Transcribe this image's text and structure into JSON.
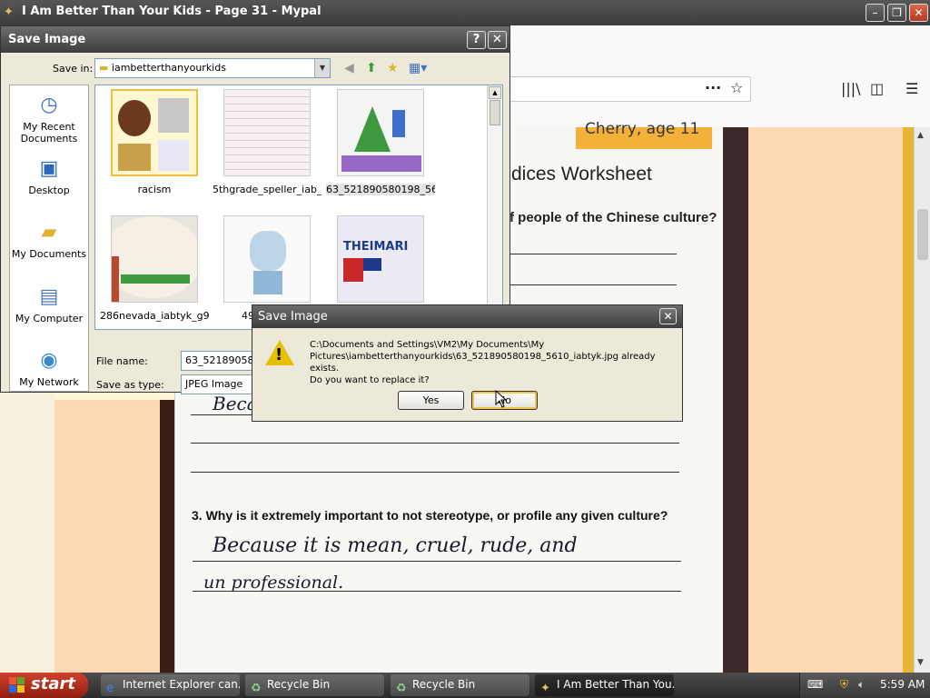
{
  "window": {
    "title": "I Am Better Than Your Kids - Page 31 - Mypal"
  },
  "browser": {
    "icons": [
      "more-icon",
      "bookmark-star-icon",
      "library-icon",
      "sidebar-icon",
      "menu-icon"
    ]
  },
  "worksheet": {
    "sticker_text": "Cherry, age 11",
    "heading": "dices Worksheet",
    "question_1": "f people of the Chinese culture?",
    "partial_answer": "Beca",
    "question_3": "3. Why is it extremely important to not stereotype, or profile any given culture?",
    "answer_line_1": "Because it is mean, cruel, rude, and",
    "answer_line_2": "un professional."
  },
  "save_dialog": {
    "title": "Save Image",
    "save_in_label": "Save in:",
    "save_in_value": "iambetterthanyourkids",
    "places": [
      {
        "label": "My Recent Documents",
        "icon": "recent-documents-icon"
      },
      {
        "label": "Desktop",
        "icon": "desktop-icon"
      },
      {
        "label": "My Documents",
        "icon": "my-documents-icon"
      },
      {
        "label": "My Computer",
        "icon": "my-computer-icon"
      },
      {
        "label": "My Network",
        "icon": "my-network-icon"
      }
    ],
    "files": [
      {
        "name": "racism"
      },
      {
        "name": "5thgrade_speller_iab_i..."
      },
      {
        "name": "63_521890580198_56..."
      },
      {
        "name": "286nevada_iabtyk_g9..."
      },
      {
        "name": "493px-0..."
      },
      {
        "name": ""
      }
    ],
    "file_name_label": "File name:",
    "file_name_value": "63_5218905801",
    "save_as_type_label": "Save as type:",
    "save_as_type_value": "JPEG Image"
  },
  "confirm_dialog": {
    "title": "Save Image",
    "message_line_1": "C:\\Documents and Settings\\VM2\\My Documents\\My",
    "message_line_2": "Pictures\\iambetterthanyourkids\\63_521890580198_5610_iabtyk.jpg already exists.",
    "message_line_3": "Do you want to replace it?",
    "yes_label": "Yes",
    "no_label": "No"
  },
  "taskbar": {
    "start_label": "start",
    "tasks": [
      {
        "label": "Internet Explorer can...",
        "icon": "internet-explorer-icon"
      },
      {
        "label": "Recycle Bin",
        "icon": "recycle-bin-icon"
      },
      {
        "label": "Recycle Bin",
        "icon": "recycle-bin-icon"
      },
      {
        "label": "I Am Better Than You...",
        "icon": "mypal-icon"
      }
    ],
    "clock": "5:59 AM"
  }
}
